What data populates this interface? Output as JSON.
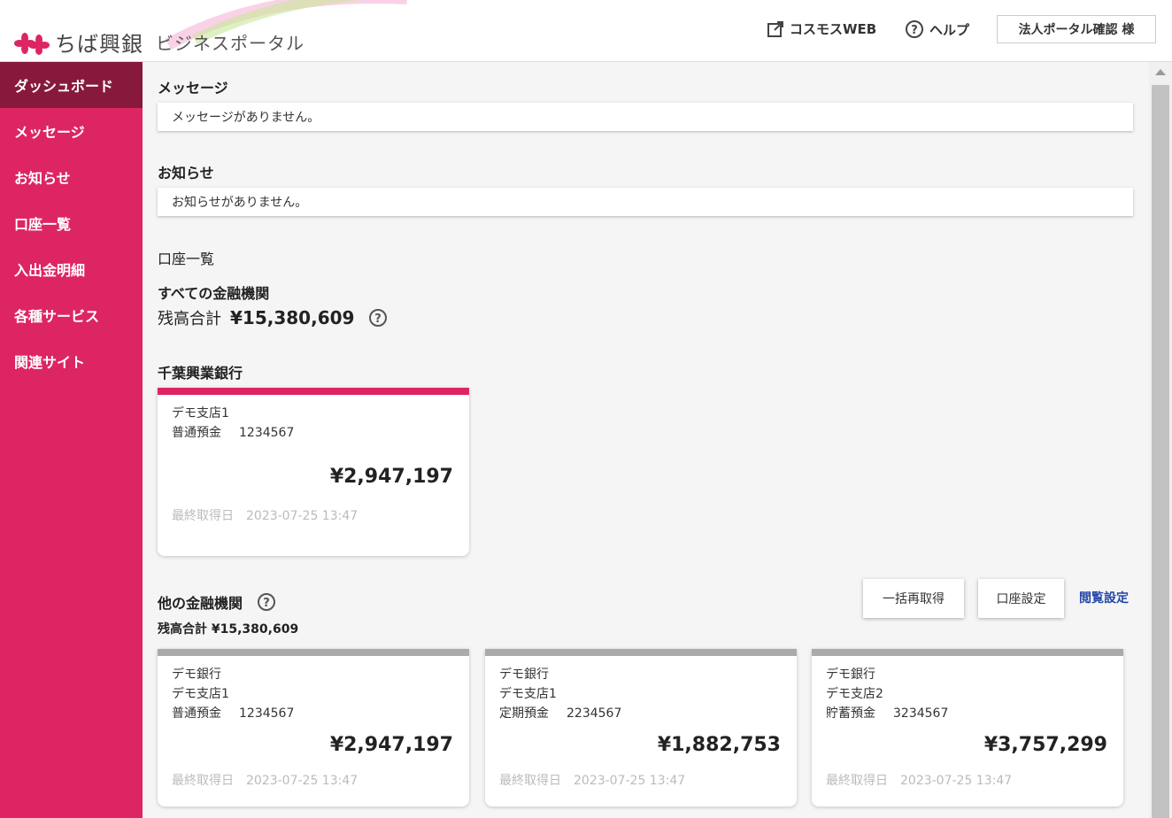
{
  "header": {
    "bank_name": "ちば興銀",
    "portal_name": "ビジネスポータル",
    "cosmos_web": "コスモスWEB",
    "help": "ヘルプ",
    "user": "法人ポータル確認 様"
  },
  "sidebar": {
    "items": [
      {
        "label": "ダッシュボード"
      },
      {
        "label": "メッセージ"
      },
      {
        "label": "お知らせ"
      },
      {
        "label": "口座一覧"
      },
      {
        "label": "入出金明細"
      },
      {
        "label": "各種サービス"
      },
      {
        "label": "関連サイト"
      }
    ]
  },
  "messages": {
    "title": "メッセージ",
    "empty": "メッセージがありません。"
  },
  "notices": {
    "title": "お知らせ",
    "empty": "お知らせがありません。"
  },
  "accounts": {
    "title": "口座一覧",
    "all_title": "すべての金融機関",
    "total_label": "残高合計",
    "total_amount": "¥15,380,609",
    "bank_title": "千葉興業銀行",
    "main_card": {
      "branch": "デモ支店1",
      "type": "普通預金",
      "number": "1234567",
      "amount": "¥2,947,197",
      "last_label": "最終取得日",
      "last_date": "2023-07-25 13:47"
    },
    "other_title": "他の金融機関",
    "other_total": "残高合計 ¥15,380,609",
    "refresh_button": "一括再取得",
    "account_settings_button": "口座設定",
    "view_settings_link": "閲覧設定",
    "other_cards": [
      {
        "bank": "デモ銀行",
        "branch": "デモ支店1",
        "type": "普通預金",
        "number": "1234567",
        "amount": "¥2,947,197",
        "last_label": "最終取得日",
        "last_date": "2023-07-25 13:47"
      },
      {
        "bank": "デモ銀行",
        "branch": "デモ支店1",
        "type": "定期預金",
        "number": "2234567",
        "amount": "¥1,882,753",
        "last_label": "最終取得日",
        "last_date": "2023-07-25 13:47"
      },
      {
        "bank": "デモ銀行",
        "branch": "デモ支店2",
        "type": "貯蓄預金",
        "number": "3234567",
        "amount": "¥3,757,299",
        "last_label": "最終取得日",
        "last_date": "2023-07-25 13:47"
      }
    ]
  },
  "colors": {
    "brand": "#dd2564",
    "sidebar_active": "#871a3c",
    "link": "#2346a8"
  }
}
